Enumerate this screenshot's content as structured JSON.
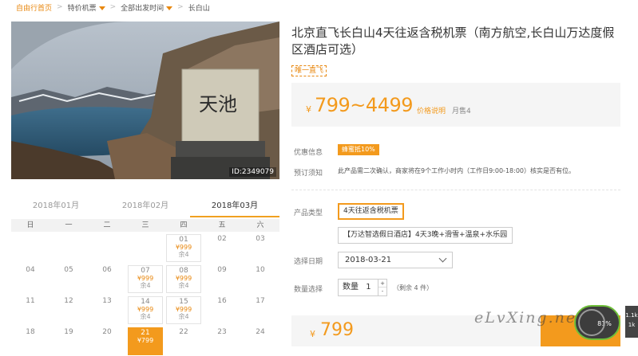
{
  "breadcrumb": {
    "items": [
      "自由行首页",
      "特价机票",
      "全部出发时间",
      "长白山"
    ],
    "separator": ">"
  },
  "photo": {
    "caption_stone": "天池",
    "id_label": "ID:2349079"
  },
  "calendar": {
    "months": [
      "2018年01月",
      "2018年02月",
      "2018年03月"
    ],
    "active_month_index": 2,
    "weekdays": [
      "日",
      "一",
      "二",
      "三",
      "四",
      "五",
      "六"
    ],
    "weeks": [
      [
        {
          "d": ""
        },
        {
          "d": ""
        },
        {
          "d": ""
        },
        {
          "d": ""
        },
        {
          "d": "01",
          "p": "¥999",
          "r": "余4"
        },
        {
          "d": "02"
        },
        {
          "d": "03"
        }
      ],
      [
        {
          "d": "04"
        },
        {
          "d": "05"
        },
        {
          "d": "06"
        },
        {
          "d": "07",
          "p": "¥999",
          "r": "余4"
        },
        {
          "d": "08",
          "p": "¥999",
          "r": "余4"
        },
        {
          "d": "09"
        },
        {
          "d": "10"
        }
      ],
      [
        {
          "d": "11"
        },
        {
          "d": "12"
        },
        {
          "d": "13"
        },
        {
          "d": "14",
          "p": "¥999",
          "r": "余4"
        },
        {
          "d": "15",
          "p": "¥999",
          "r": "余4"
        },
        {
          "d": "16"
        },
        {
          "d": "17"
        }
      ],
      [
        {
          "d": "18"
        },
        {
          "d": "19"
        },
        {
          "d": "20"
        },
        {
          "d": "21",
          "p": "¥799",
          "selected": true
        },
        {
          "d": "22"
        },
        {
          "d": "23"
        },
        {
          "d": "24"
        }
      ]
    ]
  },
  "product": {
    "title": "北京直飞长白山4天往返含税机票（南方航空,长白山万达度假区酒店可选）",
    "tag": "唯一直飞",
    "price_currency": "¥",
    "price_range": "799~4499",
    "price_note": "价格说明",
    "monthly_sales": "月售4"
  },
  "info": {
    "promo_label": "优惠信息",
    "promo_badge": "蜂蜜抵10%",
    "booking_label": "预订须知",
    "booking_text": "此产品需二次确认，商家将在9个工作小时内（工作日9:00-18:00）核实是否有位。",
    "type_label": "产品类型",
    "type_options": [
      "4天往返含税机票",
      "【万达智选假日酒店】4天3晚+滑雪+温泉+水乐园"
    ],
    "type_selected_index": 0,
    "date_label": "选择日期",
    "date_value": "2018-03-21",
    "qty_label": "数量选择",
    "qty_prefix": "数量",
    "qty_value": "1",
    "qty_plus": "+",
    "qty_minus": "-",
    "qty_remain": "（剩余 4 件）"
  },
  "footer": {
    "currency": "¥",
    "price": "799",
    "watermark": "eLvXing.net",
    "float_text": "81%",
    "side_text": [
      "1.1k",
      "1k"
    ]
  },
  "colors": {
    "accent": "#f39a1d",
    "link_orange": "#e8870e"
  }
}
